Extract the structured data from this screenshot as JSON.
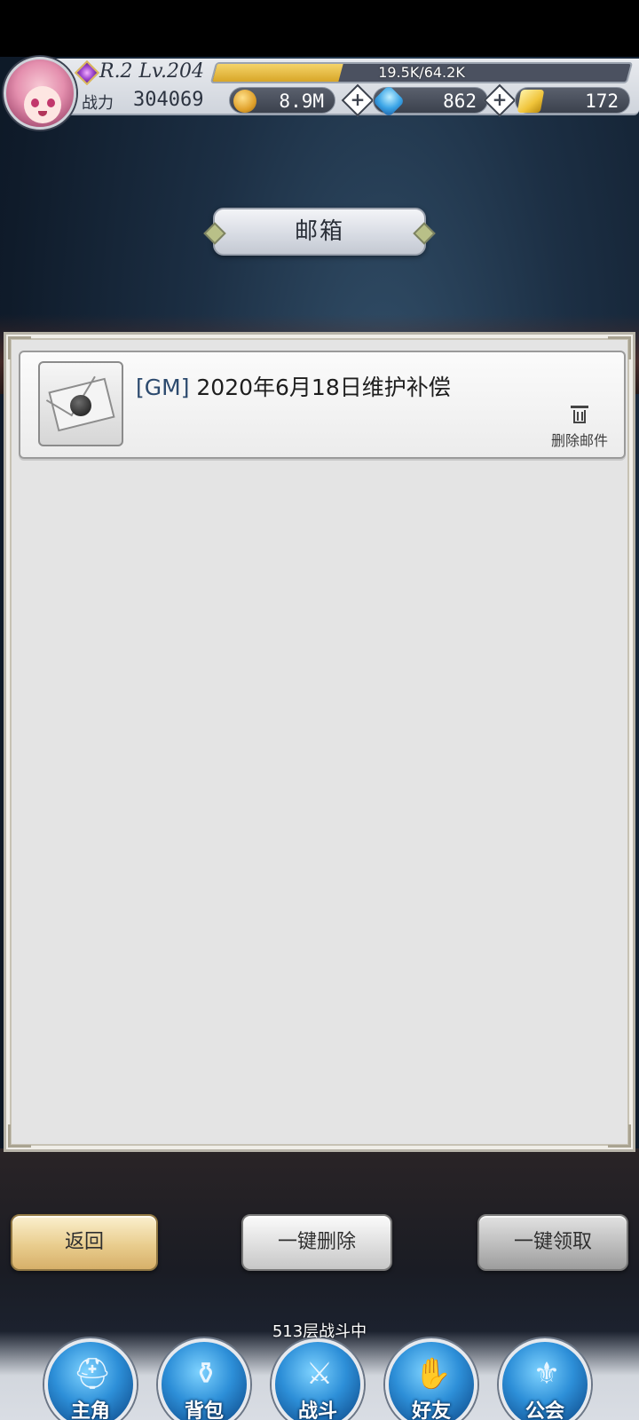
{
  "hud": {
    "rank_level": "R.2 Lv.204",
    "exp_text": "19.5K/64.2K",
    "exp_fraction": 0.304,
    "power_label": "战力",
    "power_value": "304069",
    "gold": "8.9M",
    "gems": "862",
    "tickets": "172",
    "plus_icon": "+"
  },
  "title": "邮箱",
  "mail": {
    "items": [
      {
        "tag": "[GM]",
        "subject": " 2020年6月18日维护补偿",
        "delete_label": "删除邮件"
      }
    ]
  },
  "buttons": {
    "back": "返回",
    "delete_all": "一键删除",
    "claim_all": "一键领取"
  },
  "floor_status": "513层战斗中",
  "nav": {
    "items": [
      {
        "label": "主角",
        "icon": "knight-helmet-icon"
      },
      {
        "label": "背包",
        "icon": "backpack-icon"
      },
      {
        "label": "战斗",
        "icon": "crossed-swords-icon"
      },
      {
        "label": "好友",
        "icon": "handshake-icon"
      },
      {
        "label": "公会",
        "icon": "guild-crest-icon"
      }
    ]
  }
}
